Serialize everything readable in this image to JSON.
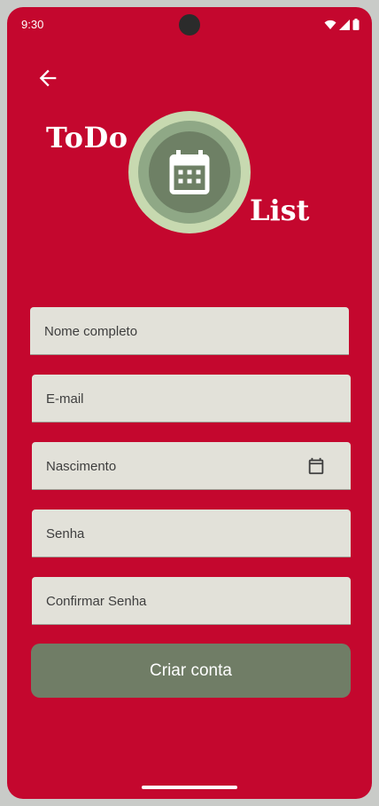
{
  "status_bar": {
    "time": "9:30"
  },
  "header": {
    "back_icon": "arrow-back-icon"
  },
  "logo": {
    "text_top": "ToDo",
    "text_bottom": "List",
    "icon": "calendar-icon",
    "colors": {
      "outer": "#c7d9b0",
      "middle": "#8fa886",
      "inner": "#6e8065"
    }
  },
  "form": {
    "full_name_placeholder": "Nome completo",
    "email_placeholder": "E-mail",
    "birth_date_placeholder": "Nascimento",
    "birth_date_icon": "calendar-icon",
    "password_placeholder": "Senha",
    "confirm_password_placeholder": "Confirmar Senha",
    "submit_label": "Criar conta"
  },
  "colors": {
    "background": "#c4072e",
    "field": "#e2e1d9",
    "button": "#707d66"
  }
}
